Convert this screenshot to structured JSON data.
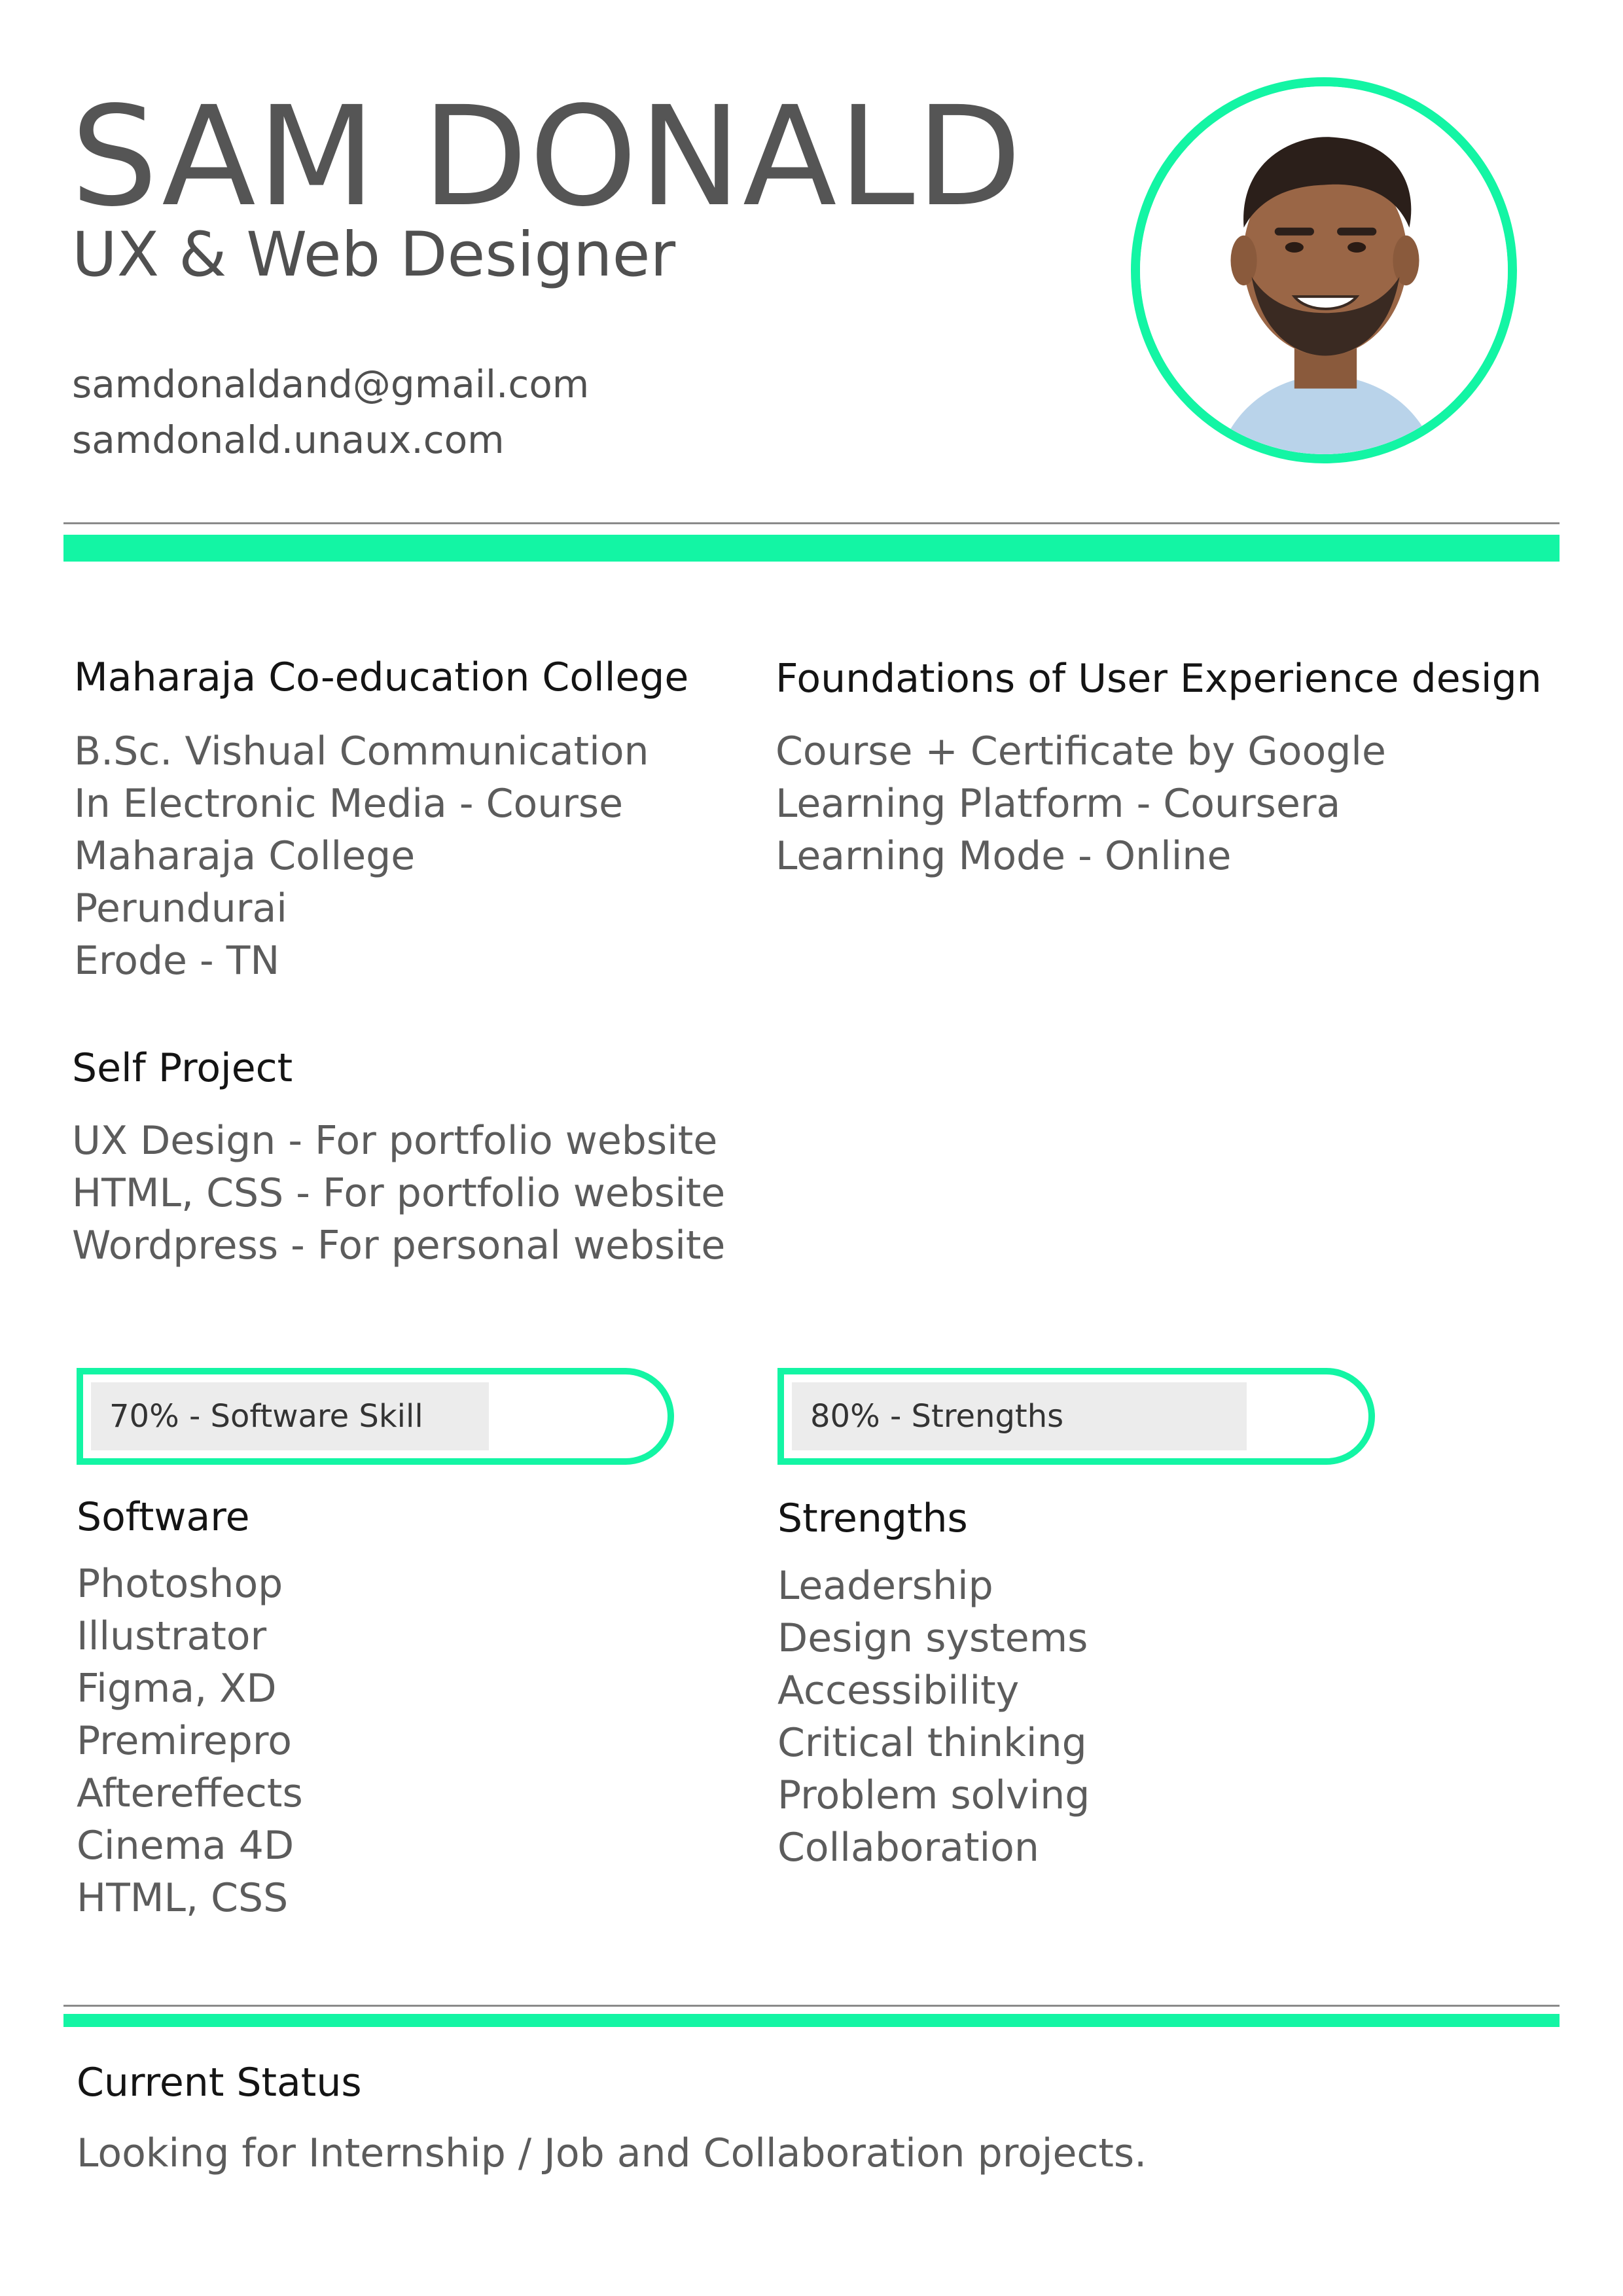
{
  "header": {
    "name": "SAM DONALD",
    "title": "UX & Web Designer",
    "email": "samdonaldand@gmail.com",
    "website": "samdonald.unaux.com",
    "photo_icon": "profile-photo"
  },
  "colors": {
    "accent": "#13f5a4",
    "text": "#555555",
    "heading": "#141414",
    "bar_fill": "#ececec"
  },
  "education": {
    "heading": "Maharaja Co-education College",
    "lines": [
      "B.Sc. Vishual Communication",
      "In Electronic Media - Course",
      "Maharaja College",
      "Perundurai",
      "Erode - TN"
    ]
  },
  "course": {
    "heading": "Foundations of User Experience design",
    "lines": [
      "Course + Certificate by Google",
      "Learning Platform - Coursera",
      "Learning Mode - Online"
    ]
  },
  "self_project": {
    "heading": "Self Project",
    "lines": [
      "UX Design - For portfolio website",
      "HTML, CSS - For portfolio website",
      "Wordpress - For personal website"
    ]
  },
  "skill_bars": [
    {
      "label": "70% - Software Skill",
      "value": 0.7
    },
    {
      "label": "80% - Strengths",
      "value": 0.8
    }
  ],
  "software": {
    "heading": "Software",
    "lines": [
      "Photoshop",
      "Illustrator",
      "Figma, XD",
      "Premirepro",
      "Aftereffects",
      "Cinema 4D",
      "HTML, CSS"
    ]
  },
  "strengths": {
    "heading": "Strengths",
    "lines": [
      "Leadership",
      "Design systems",
      "Accessibility",
      "Critical thinking",
      "Problem solving",
      "Collaboration"
    ]
  },
  "status": {
    "heading": "Current Status",
    "text": "Looking for Internship / Job and Collaboration projects."
  }
}
